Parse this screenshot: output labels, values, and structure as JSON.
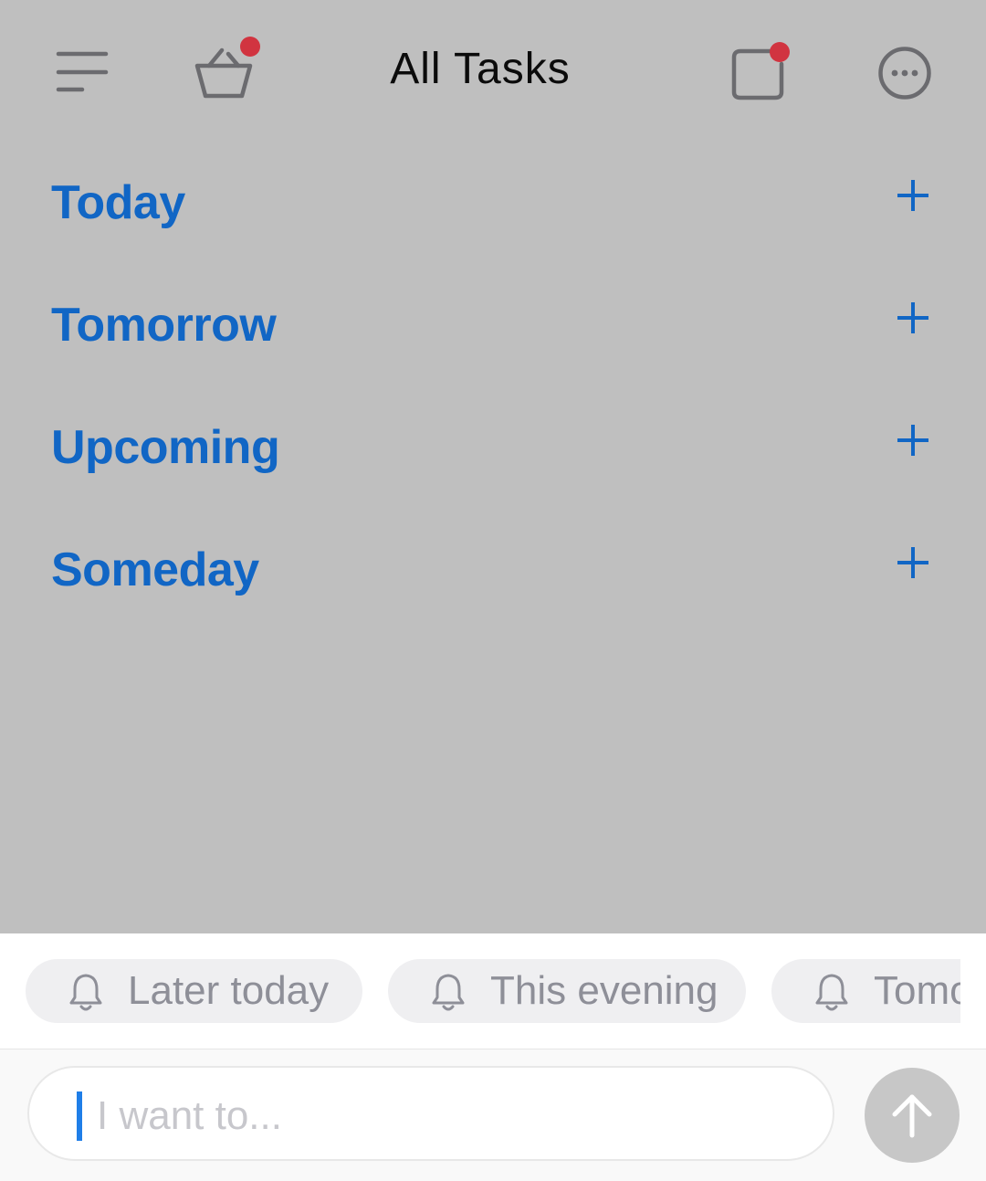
{
  "header": {
    "title": "All Tasks",
    "icons": {
      "menu": "hamburger-menu-icon",
      "basket": "basket-icon",
      "quick_note": "square-note-icon",
      "more": "more-options-icon"
    },
    "badge_color": "#d13440"
  },
  "sections": [
    {
      "label": "Today"
    },
    {
      "label": "Tomorrow"
    },
    {
      "label": "Upcoming"
    },
    {
      "label": "Someday"
    }
  ],
  "reminder_chips": [
    {
      "label": "Later today",
      "icon": "bell-icon"
    },
    {
      "label": "This evening",
      "icon": "bell-icon"
    },
    {
      "label": "Tomorrow",
      "icon": "bell-icon"
    }
  ],
  "composer": {
    "placeholder": "I want to...",
    "send_icon": "arrow-up-icon"
  },
  "colors": {
    "accent": "#1166c5",
    "overlay": "#bfbfbf",
    "caret": "#1f7ee8"
  }
}
